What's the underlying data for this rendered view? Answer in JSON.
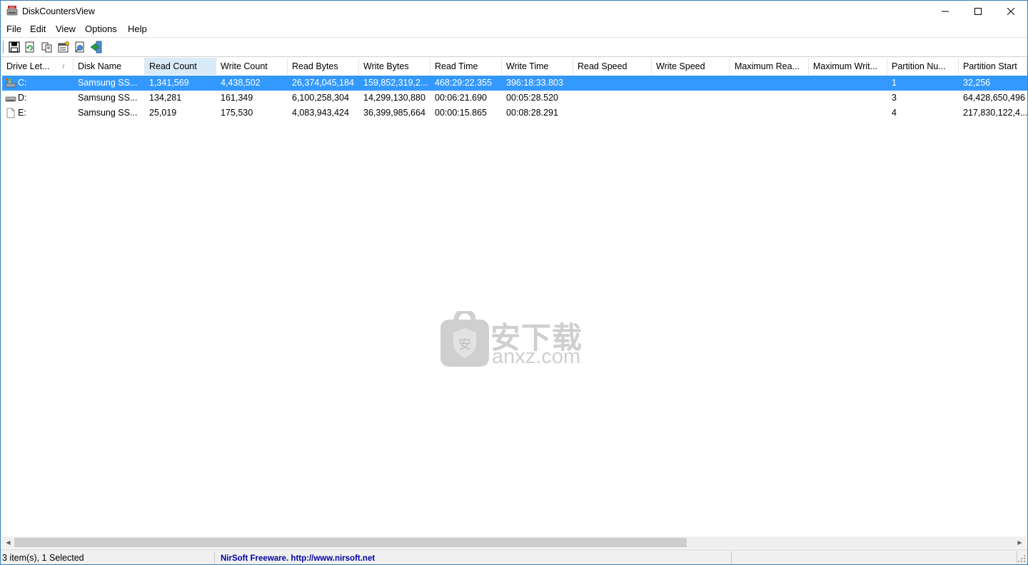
{
  "window": {
    "title": "DiskCountersView"
  },
  "menu": [
    "File",
    "Edit",
    "View",
    "Options",
    "Help"
  ],
  "toolbar": [
    {
      "name": "save-icon"
    },
    {
      "name": "refresh-icon"
    },
    {
      "name": "copy-icon"
    },
    {
      "name": "properties-icon"
    },
    {
      "name": "html-report-icon"
    },
    {
      "name": "exit-icon"
    }
  ],
  "columns": [
    "Drive Let...",
    "Disk Name",
    "Read Count",
    "Write Count",
    "Read Bytes",
    "Write Bytes",
    "Read Time",
    "Write Time",
    "Read Speed",
    "Write Speed",
    "Maximum Rea...",
    "Maximum Writ...",
    "Partition Nu...",
    "Partition Start"
  ],
  "sort_indicator": "/",
  "rows": [
    {
      "selected": true,
      "icon": "system-drive-icon",
      "cells": [
        "C:",
        "Samsung SS...",
        "1,341,569",
        "4,438,502",
        "26,374,045,184",
        "159,852,319,2...",
        "468:29:22.355",
        "396:18:33.803",
        "",
        "",
        "",
        "",
        "1",
        "32,256"
      ]
    },
    {
      "selected": false,
      "icon": "hard-drive-icon",
      "cells": [
        "D:",
        "Samsung SS...",
        "134,281",
        "161,349",
        "6,100,258,304",
        "14,299,130,880",
        "00:06:21.690",
        "00:05:28.520",
        "",
        "",
        "",
        "",
        "3",
        "64,428,650,496"
      ]
    },
    {
      "selected": false,
      "icon": "blank-drive-icon",
      "cells": [
        "E:",
        "Samsung SS...",
        "25,019",
        "175,530",
        "4,083,943,424",
        "36,399,985,664",
        "00:00:15.865",
        "00:08:28.291",
        "",
        "",
        "",
        "",
        "4",
        "217,830,122,4..."
      ]
    }
  ],
  "watermark": {
    "cn": "安下载",
    "en": "anxz.com",
    "shield": "安"
  },
  "status": {
    "items": "3 item(s), 1 Selected",
    "freeware": "NirSoft Freeware.  http://www.nirsoft.net"
  }
}
